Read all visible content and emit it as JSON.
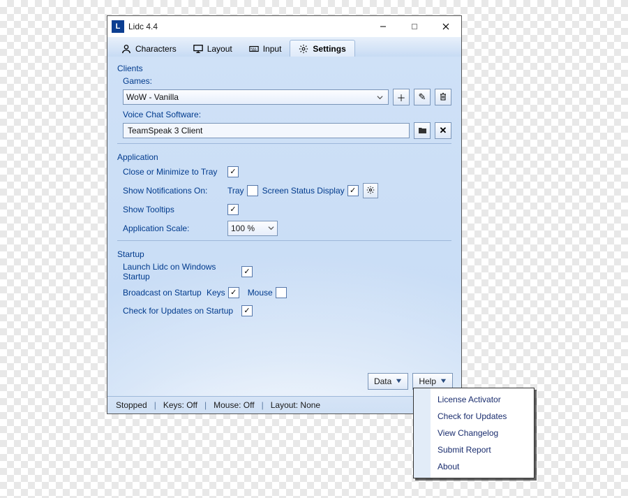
{
  "window": {
    "title": "Lidc 4.4"
  },
  "tabs": {
    "characters": "Characters",
    "layout": "Layout",
    "input": "Input",
    "settings": "Settings"
  },
  "clients": {
    "group": "Clients",
    "games_label": "Games:",
    "games_value": "WoW - Vanilla",
    "voice_label": "Voice Chat Software:",
    "voice_value": "TeamSpeak 3 Client"
  },
  "application": {
    "group": "Application",
    "close_tray": "Close or Minimize to Tray",
    "notifications": "Show Notifications On:",
    "notif_tray": "Tray",
    "notif_screen": "Screen Status Display",
    "tooltips": "Show Tooltips",
    "scale_label": "Application Scale:",
    "scale_value": "100 %"
  },
  "startup": {
    "group": "Startup",
    "launch": "Launch Lidc on Windows Startup",
    "broadcast": "Broadcast on Startup",
    "keys": "Keys",
    "mouse": "Mouse",
    "updates": "Check for Updates on Startup"
  },
  "footer": {
    "data": "Data",
    "help": "Help"
  },
  "status": {
    "stopped": "Stopped",
    "keys": "Keys: Off",
    "mouse": "Mouse: Off",
    "layout": "Layout: None"
  },
  "help_menu": {
    "license": "License Activator",
    "updates": "Check for Updates",
    "changelog": "View Changelog",
    "report": "Submit Report",
    "about": "About"
  }
}
